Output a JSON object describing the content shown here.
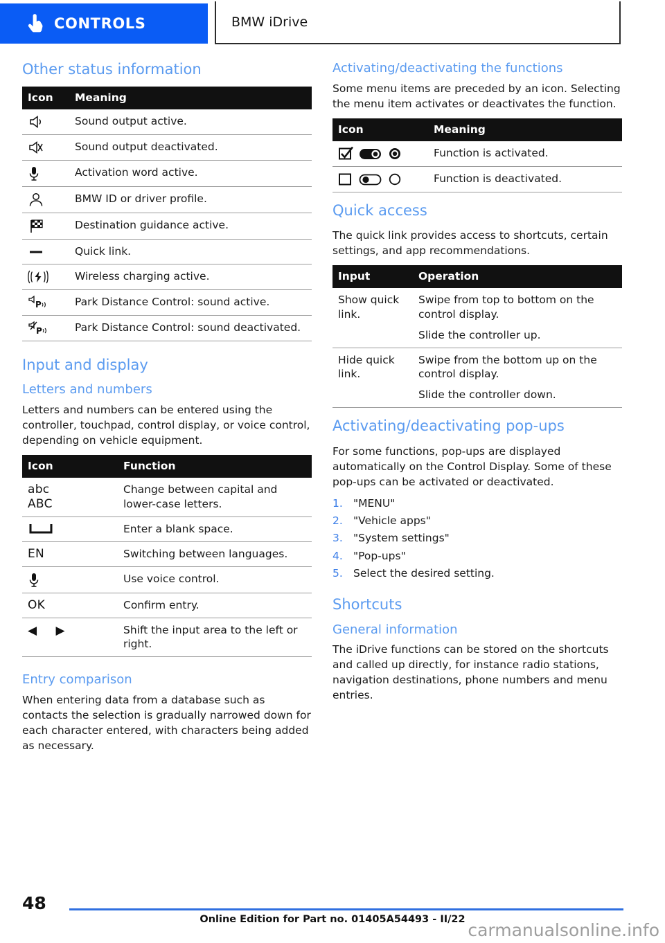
{
  "header": {
    "tab_controls_label": "CONTROLS",
    "tab_chapter_label": "BMW iDrive",
    "hand_icon": "pointing-hand-icon",
    "accent_blue": "#0A5CF5"
  },
  "colors": {
    "heading_blue": "#5B9BF0",
    "tab_blue": "#0A5CF5",
    "table_header_bg": "#111111",
    "rule_blue": "#2F6FE0"
  },
  "left_column": {
    "status_section": {
      "heading": "Other status information",
      "table": {
        "headers": [
          "Icon",
          "Meaning"
        ],
        "rows": [
          {
            "icon": "speaker-on-icon",
            "meaning": "Sound output active."
          },
          {
            "icon": "speaker-muted-icon",
            "meaning": "Sound output deactivated."
          },
          {
            "icon": "microphone-icon",
            "meaning": "Activation word active."
          },
          {
            "icon": "person-profile-icon",
            "meaning": "BMW ID or driver profile."
          },
          {
            "icon": "checkered-flag-icon",
            "meaning": "Destination guidance active."
          },
          {
            "icon": "dash-quick-link-icon",
            "meaning": "Quick link."
          },
          {
            "icon": "wireless-charging-icon",
            "meaning": "Wireless charging active."
          },
          {
            "icon": "pdc-sound-on-icon",
            "meaning": "Park Distance Control: sound active."
          },
          {
            "icon": "pdc-sound-off-icon",
            "meaning": "Park Distance Control: sound deactivated."
          }
        ]
      }
    },
    "input_display_section": {
      "heading": "Input and display",
      "subheading": "Letters and numbers",
      "paragraph": "Letters and numbers can be entered using the controller, touchpad, control display, or voice control, depending on vehicle equipment.",
      "table": {
        "headers": [
          "Icon",
          "Function"
        ],
        "rows": [
          {
            "icon": "abc-case-icon",
            "glyph_line1": "abc",
            "glyph_line2": "ABC",
            "function": "Change between capital and lower-case letters."
          },
          {
            "icon": "space-bar-icon",
            "function": "Enter a blank space."
          },
          {
            "icon": "language-en-icon",
            "glyph_line1": "EN",
            "function": "Switching between languages."
          },
          {
            "icon": "microphone-icon",
            "function": "Use voice control."
          },
          {
            "icon": "ok-confirm-icon",
            "glyph_line1": "OK",
            "function": "Confirm entry."
          },
          {
            "icon": "left-right-arrows-icon",
            "glyph_line1": "◀  ▶",
            "function": "Shift the input area to the left or right."
          }
        ]
      }
    },
    "entry_comparison_section": {
      "heading": "Entry comparison",
      "paragraph": "When entering data from a database such as contacts the selection is gradually narrowed down for each character entered, with characters being added as necessary."
    }
  },
  "right_column": {
    "activating_functions_section": {
      "heading": "Activating/deactivating the functions",
      "paragraph": "Some menu items are preceded by an icon. Selecting the menu item activates or deactivates the function.",
      "table": {
        "headers": [
          "Icon",
          "Meaning"
        ],
        "rows": [
          {
            "icons": [
              "checkbox-checked-icon",
              "toggle-on-icon",
              "radio-selected-icon"
            ],
            "meaning": "Function is activated."
          },
          {
            "icons": [
              "checkbox-unchecked-icon",
              "toggle-off-icon",
              "radio-unselected-icon"
            ],
            "meaning": "Function is deactivated."
          }
        ]
      }
    },
    "quick_access_section": {
      "heading": "Quick access",
      "paragraph": "The quick link provides access to shortcuts, certain settings, and app recommendations.",
      "table": {
        "headers": [
          "Input",
          "Operation"
        ],
        "rows": [
          {
            "input": "Show quick link.",
            "operations": [
              "Swipe from top to bottom on the control display.",
              "Slide the controller up."
            ]
          },
          {
            "input": "Hide quick link.",
            "operations": [
              "Swipe from the bottom up on the control display.",
              "Slide the controller down."
            ]
          }
        ]
      }
    },
    "popups_section": {
      "heading": "Activating/deactivating pop-ups",
      "paragraph": "For some functions, pop-ups are displayed automatically on the Control Display. Some of these pop-ups can be activated or deactivated.",
      "steps": [
        "\"MENU\"",
        "\"Vehicle apps\"",
        "\"System settings\"",
        "\"Pop-ups\"",
        "Select the desired setting."
      ]
    },
    "shortcuts_section": {
      "heading": "Shortcuts",
      "subheading": "General information",
      "paragraph": "The iDrive functions can be stored on the shortcuts and called up directly, for instance radio stations, navigation destinations, phone numbers and menu entries."
    }
  },
  "footer": {
    "page_number": "48",
    "edition_text": "Online Edition for Part no. 01405A54493 - II/22",
    "watermark": "carmanualsonline.info"
  }
}
